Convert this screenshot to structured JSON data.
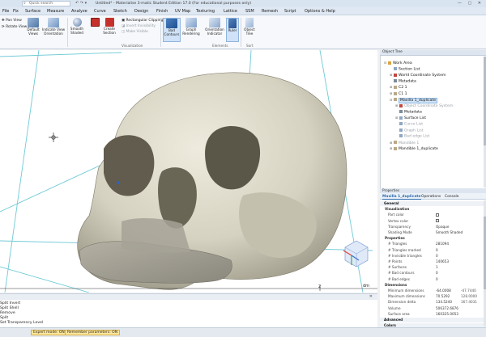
{
  "titlebar": {
    "search_placeholder": "Quick search",
    "title": "Untitled* - Materialise 3-matic Student Edition 17.0 (For educational purposes only)",
    "window_controls": "— ▢ ✕"
  },
  "menu": [
    "File",
    "Fix",
    "Surface",
    "Measure",
    "Analyze",
    "Curve",
    "Sketch",
    "Design",
    "Finish",
    "UV Map",
    "Texturing",
    "Lattice",
    "SSM",
    "Remesh",
    "Script",
    "Options & Help"
  ],
  "ribbon": {
    "view_small": [
      "Pan View",
      "Rotate View"
    ],
    "default_views": "Default Views",
    "indicate_view": "Indicate View Orientation",
    "smooth_shaded": "Smooth Shaded",
    "create_section": "Create Section",
    "clipping_small": [
      "Rectangular Clipping",
      "Invert Invisibility",
      "Make Visible"
    ],
    "visualization_label": "Visualization",
    "bad_contours": "Bad Contours",
    "graph_rendering": "Graph Rendering",
    "orientation_indicator": "Orientation Indicator",
    "ruler": "Ruler",
    "elements_label": "Elements",
    "object_tree": "Object Tree",
    "sort_label": "Sort"
  },
  "object_tree": {
    "header": "Object Tree",
    "nodes": [
      {
        "label": "Work Area",
        "depth": 0,
        "icon": "folder",
        "dim": false,
        "sel": false,
        "toggle": "−"
      },
      {
        "label": "Section List",
        "depth": 1,
        "icon": "list",
        "dim": false,
        "sel": false,
        "toggle": ""
      },
      {
        "label": "World Coordinate System",
        "depth": 1,
        "icon": "axes",
        "dim": false,
        "sel": false,
        "toggle": "+"
      },
      {
        "label": "Metadata",
        "depth": 1,
        "icon": "meta",
        "dim": false,
        "sel": false,
        "toggle": ""
      },
      {
        "label": "C2 1",
        "depth": 1,
        "icon": "part",
        "dim": false,
        "sel": false,
        "toggle": "+"
      },
      {
        "label": "C1 1",
        "depth": 1,
        "icon": "part",
        "dim": false,
        "sel": false,
        "toggle": "+"
      },
      {
        "label": "Maxilla 1_duplicate",
        "depth": 1,
        "icon": "part",
        "dim": false,
        "sel": true,
        "toggle": "−"
      },
      {
        "label": "Object Coordinate System",
        "depth": 2,
        "icon": "axes",
        "dim": true,
        "sel": false,
        "toggle": "+"
      },
      {
        "label": "Metadata",
        "depth": 2,
        "icon": "meta",
        "dim": false,
        "sel": false,
        "toggle": ""
      },
      {
        "label": "Surface List",
        "depth": 2,
        "icon": "list",
        "dim": false,
        "sel": false,
        "toggle": "+"
      },
      {
        "label": "Curve List",
        "depth": 2,
        "icon": "list",
        "dim": true,
        "sel": false,
        "toggle": ""
      },
      {
        "label": "Graph List",
        "depth": 2,
        "icon": "list",
        "dim": true,
        "sel": false,
        "toggle": ""
      },
      {
        "label": "Bad edge List",
        "depth": 2,
        "icon": "list",
        "dim": true,
        "sel": false,
        "toggle": ""
      },
      {
        "label": "Mandible 1",
        "depth": 1,
        "icon": "part",
        "dim": true,
        "sel": false,
        "toggle": "+"
      },
      {
        "label": "Mandible 1_duplicate",
        "depth": 1,
        "icon": "part",
        "dim": false,
        "sel": false,
        "toggle": "+"
      }
    ]
  },
  "properties": {
    "header": "Properties",
    "tabs": [
      "Maxilla 1_duplicate",
      "Operations",
      "Console"
    ],
    "rows": [
      {
        "type": "sec",
        "k": "General"
      },
      {
        "type": "sub",
        "k": "Visualization"
      },
      {
        "type": "row",
        "k": "Part color",
        "v": "",
        "v2": "",
        "chk": true
      },
      {
        "type": "row",
        "k": "Vertex color",
        "v": "",
        "v2": "",
        "chk": true
      },
      {
        "type": "row",
        "k": "Transparency",
        "v": "Opaque",
        "v2": ""
      },
      {
        "type": "row",
        "k": "Shading Mode",
        "v": "Smooth Shaded",
        "v2": ""
      },
      {
        "type": "sub",
        "k": "Properties"
      },
      {
        "type": "row",
        "k": "# Triangles",
        "v": "281094",
        "v2": ""
      },
      {
        "type": "row",
        "k": "# Triangles marked",
        "v": "0",
        "v2": ""
      },
      {
        "type": "row",
        "k": "# Invisible triangles",
        "v": "0",
        "v2": ""
      },
      {
        "type": "row",
        "k": "# Points",
        "v": "140653",
        "v2": ""
      },
      {
        "type": "row",
        "k": "# Surfaces",
        "v": "1",
        "v2": ""
      },
      {
        "type": "row",
        "k": "# Bad contours",
        "v": "0",
        "v2": ""
      },
      {
        "type": "row",
        "k": "# Bad edges",
        "v": "0",
        "v2": ""
      },
      {
        "type": "sub",
        "k": "Dimensions"
      },
      {
        "type": "row",
        "k": "Minimum dimensions",
        "v": "-64.0008",
        "v2": "-47.7440"
      },
      {
        "type": "row",
        "k": "Maximum dimensions",
        "v": "70.5292",
        "v2": "128.0000"
      },
      {
        "type": "row",
        "k": "Dimension delta",
        "v": "134.5240",
        "v2": "167.4031"
      },
      {
        "type": "row",
        "k": "Volume",
        "v": "506372.6876",
        "v2": ""
      },
      {
        "type": "row",
        "k": "Surface area",
        "v": "160325.0053",
        "v2": ""
      },
      {
        "type": "sec",
        "k": "Advanced"
      },
      {
        "type": "sec",
        "k": "Colors"
      }
    ]
  },
  "viewport": {
    "ruler_tick": "2",
    "unit": "dm"
  },
  "log": {
    "lines": [
      "Split Invert",
      "Split Shell",
      "Remove",
      "Split",
      "Set Transparency Level"
    ]
  },
  "status": {
    "chips": [
      "Expert mode: ON",
      "Remember parameters: ON"
    ]
  },
  "colors": {
    "bone": "#dcd8c8",
    "bone_shadow": "#8e8a7c",
    "accent": "#2b6cb0",
    "guide_lines": "#66c9d6"
  }
}
